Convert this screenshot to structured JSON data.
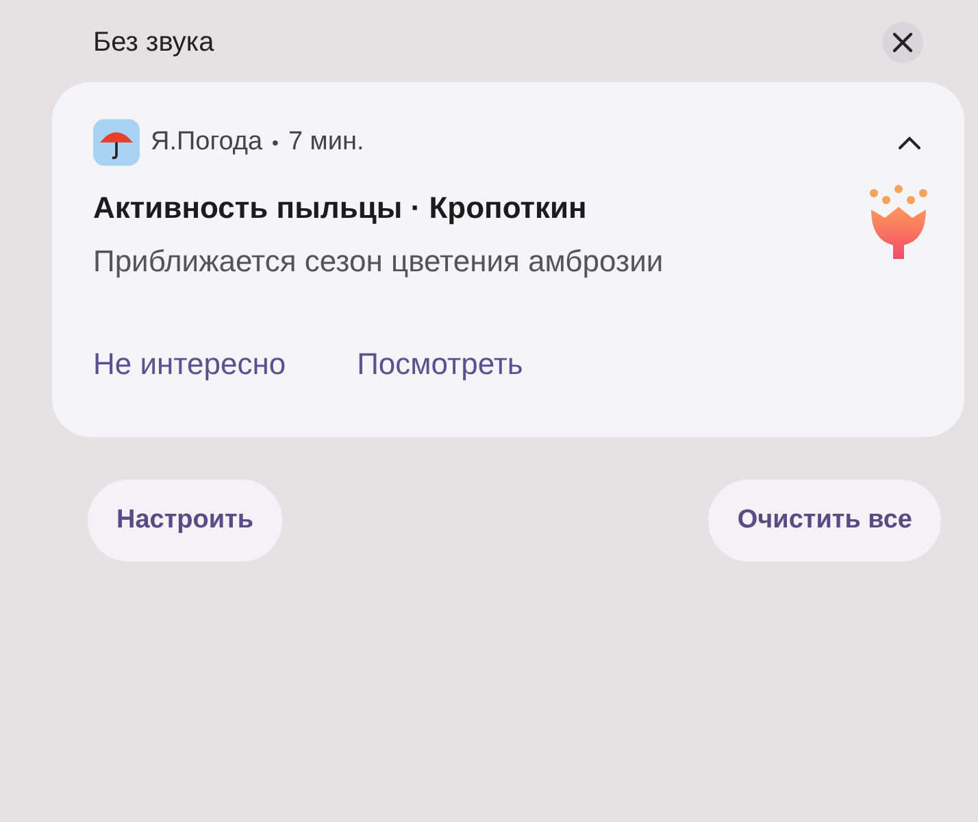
{
  "section": {
    "title": "Без звука"
  },
  "notification": {
    "app": "Я.Погода",
    "separator": "•",
    "time": "7 мин.",
    "expanded": true,
    "title": "Активность пыльцы · Кропоткин",
    "text": "Приближается сезон цветения амброзии",
    "actions": [
      "Не интересно",
      "Посмотреть"
    ]
  },
  "buttons": [
    "Настроить",
    "Очистить все"
  ]
}
